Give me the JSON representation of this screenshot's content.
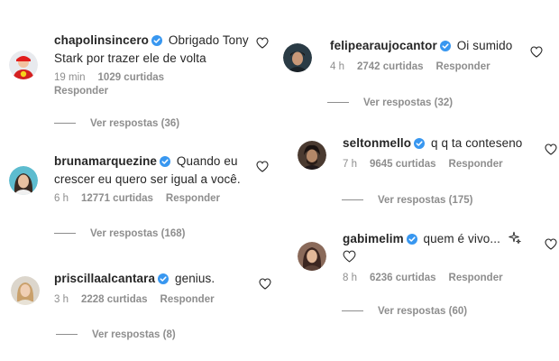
{
  "colors": {
    "verified": "#3897f0",
    "text": "#262626",
    "meta": "#8e8e8e"
  },
  "comments": [
    {
      "username": "chapolinsincero",
      "text": "Obrigado Tony Stark por trazer ele de volta",
      "time": "19 min",
      "likes": "1029 curtidas",
      "reply_label": "Responder",
      "replies_label": "Ver respostas (36)",
      "avatar": "chapolin-avatar"
    },
    {
      "username": "brunamarquezine",
      "text": "Quando eu crescer eu quero ser igual a você.",
      "time": "6 h",
      "likes": "12771 curtidas",
      "reply_label": "Responder",
      "replies_label": "Ver respostas (168)",
      "avatar": "bruna-avatar"
    },
    {
      "username": "priscillaalcantara",
      "text": "genius.",
      "time": "3 h",
      "likes": "2228 curtidas",
      "reply_label": "Responder",
      "replies_label": "Ver respostas (8)",
      "avatar": "priscilla-avatar"
    },
    {
      "username": "felipearaujocantor",
      "text": "Oi sumido",
      "time": "4 h",
      "likes": "2742 curtidas",
      "reply_label": "Responder",
      "replies_label": "Ver respostas (32)",
      "avatar": "felipe-avatar"
    },
    {
      "username": "seltonmello",
      "text": "q q ta conteseno",
      "time": "7 h",
      "likes": "9645 curtidas",
      "reply_label": "Responder",
      "replies_label": "Ver respostas (175)",
      "avatar": "selton-avatar"
    },
    {
      "username": "gabimelim",
      "text": "quem é vivo...",
      "time": "8 h",
      "likes": "6236 curtidas",
      "reply_label": "Responder",
      "replies_label": "Ver respostas (60)",
      "avatar": "gabi-avatar"
    }
  ]
}
